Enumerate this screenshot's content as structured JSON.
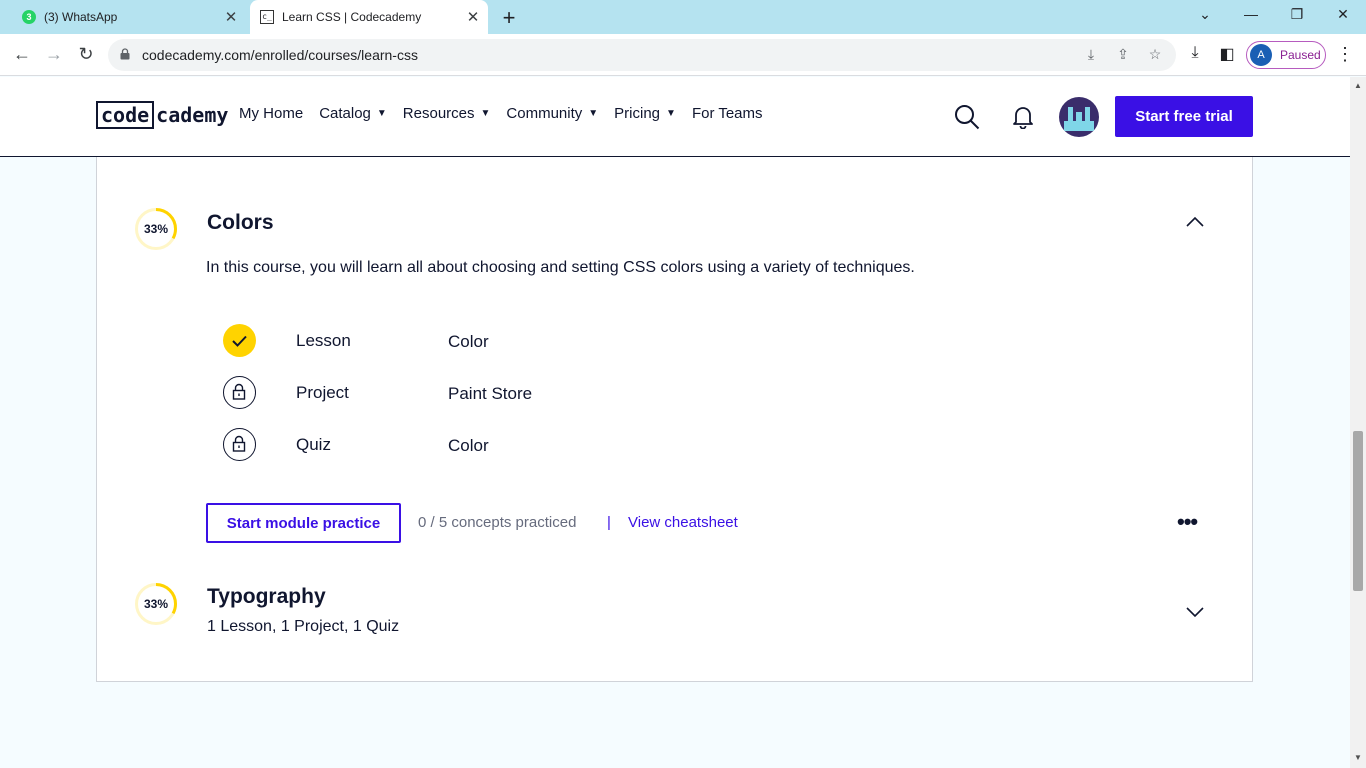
{
  "browser": {
    "tabs": [
      {
        "title": "(3) WhatsApp",
        "badge": "3"
      },
      {
        "title": "Learn CSS | Codecademy"
      }
    ],
    "url": "codecademy.com/enrolled/courses/learn-css",
    "profile": {
      "initial": "A",
      "status": "Paused"
    }
  },
  "header": {
    "logo": {
      "part1": "code",
      "part2": "cademy"
    },
    "nav": [
      {
        "label": "My Home",
        "caret": ""
      },
      {
        "label": "Catalog",
        "caret": "▼"
      },
      {
        "label": "Resources",
        "caret": "▼"
      },
      {
        "label": "Community",
        "caret": "▼"
      },
      {
        "label": "Pricing",
        "caret": "▼"
      },
      {
        "label": "For Teams",
        "caret": ""
      }
    ],
    "cta": "Start free trial"
  },
  "modules": [
    {
      "progress": "33%",
      "progress_fraction": 0.33,
      "title": "Colors",
      "description": "In this course, you will learn all about choosing and setting CSS colors using a variety of techniques.",
      "expanded": true,
      "items": [
        {
          "type": "Lesson",
          "name": "Color",
          "status": "completed"
        },
        {
          "type": "Project",
          "name": "Paint Store",
          "status": "locked"
        },
        {
          "type": "Quiz",
          "name": "Color",
          "status": "locked"
        }
      ],
      "practice_button": "Start module practice",
      "concepts": "0 / 5 concepts practiced",
      "separator": "|",
      "cheatsheet": "View cheatsheet",
      "more": "•••"
    },
    {
      "progress": "33%",
      "progress_fraction": 0.33,
      "title": "Typography",
      "summary": "1 Lesson, 1 Project, 1 Quiz",
      "expanded": false
    }
  ],
  "colors": {
    "brand": "#3a10e5",
    "progress": "#ffd300",
    "text": "#10162f"
  }
}
